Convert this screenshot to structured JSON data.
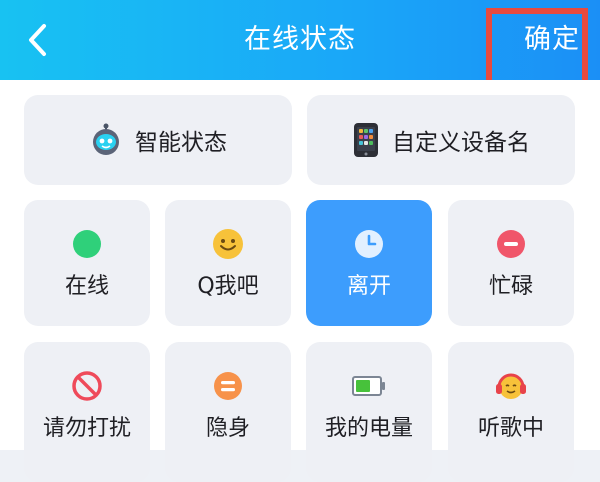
{
  "header": {
    "title": "在线状态",
    "confirm_label": "确定",
    "bg_colors": [
      "#18c2f2",
      "#1b8ff6"
    ]
  },
  "annotation": {
    "color": "#e84a3f"
  },
  "top_options": [
    {
      "label": "智能状态",
      "icon": "robot-icon"
    },
    {
      "label": "自定义设备名",
      "icon": "phone-icon"
    }
  ],
  "statuses": [
    {
      "label": "在线",
      "icon": "green-dot-icon",
      "color": "#2fd07a"
    },
    {
      "label": "Q我吧",
      "icon": "smile-icon",
      "color": "#f5b531"
    },
    {
      "label": "离开",
      "icon": "clock-icon",
      "color": "#ffffff",
      "selected": true
    },
    {
      "label": "忙碌",
      "icon": "minus-circle-icon",
      "color": "#f0566a"
    },
    {
      "label": "请勿打扰",
      "icon": "prohibit-icon",
      "color": "#ef4a5a"
    },
    {
      "label": "隐身",
      "icon": "equals-circle-icon",
      "color": "#f7924a"
    },
    {
      "label": "我的电量",
      "icon": "battery-icon",
      "color": "#47c23b"
    },
    {
      "label": "听歌中",
      "icon": "headphones-emoji-icon",
      "color": "#e8434a"
    }
  ],
  "accent": "#3d9dfd"
}
